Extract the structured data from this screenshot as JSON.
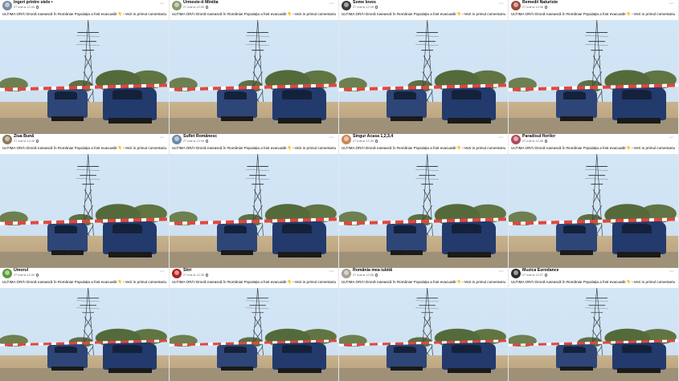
{
  "posts": [
    {
      "page": "Îngeri printre stele",
      "suffix": "•",
      "date": "27 mai la 12:40",
      "avatar_color": "#7a8ea3"
    },
    {
      "page": "Urmeste-ti Minitia",
      "suffix": "",
      "date": "27 mai la 12:39",
      "avatar_color": "#8a9a6d"
    },
    {
      "page": "Some loves",
      "suffix": "",
      "date": "27 mai la 12:39",
      "avatar_color": "#3b3b3b"
    },
    {
      "page": "Remedii Naturiste",
      "suffix": "",
      "date": "27 mai la 12:38",
      "avatar_color": "#9b4a3a"
    },
    {
      "page": "Ziua Bună",
      "suffix": "",
      "date": "27 mai la 12:40",
      "avatar_color": "#8c7a5c"
    },
    {
      "page": "Suflet Românesc",
      "suffix": "",
      "date": "27 mai la 12:39",
      "avatar_color": "#6d8aa8"
    },
    {
      "page": "Singur Acasa 1,2,3,4",
      "suffix": "",
      "date": "27 mai la 12:39",
      "avatar_color": "#c9875a"
    },
    {
      "page": "Paradisul florilor",
      "suffix": "",
      "date": "27 mai la 12:38",
      "avatar_color": "#b04a5a"
    },
    {
      "page": "Umorul",
      "suffix": "",
      "date": "27 mai la 12:40",
      "avatar_color": "#5a9a3b"
    },
    {
      "page": "Stiri",
      "suffix": "",
      "date": "27 mai la 12:38",
      "avatar_color": "#b02020"
    },
    {
      "page": "România mea iubită",
      "suffix": "",
      "date": "27 mai la 12:38",
      "avatar_color": "#a8a090"
    },
    {
      "page": "Muzica Eurodance",
      "suffix": "",
      "date": "27 mai la 12:37",
      "avatar_color": "#2c2c2c"
    }
  ],
  "caption": "ULTIMA ORĂ! Dronă rusească în România! Populația a fost evacuată! 👇--Vezi in primul comentariu",
  "menu_glyph": "···",
  "icons": {
    "audience": "globe-icon",
    "menu": "more-options-icon"
  }
}
